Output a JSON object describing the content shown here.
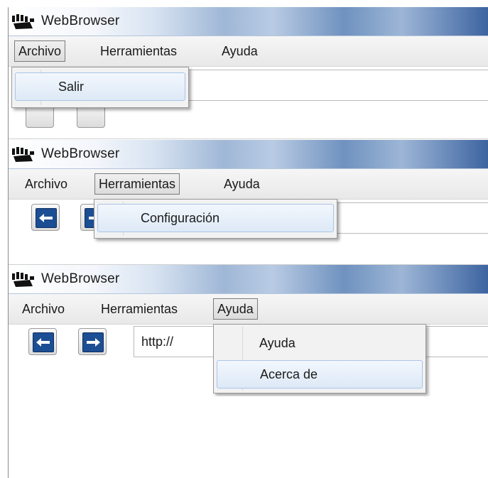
{
  "app": {
    "title": "WebBrowser"
  },
  "menu": {
    "archivo": "Archivo",
    "herramientas": "Herramientas",
    "ayuda": "Ayuda"
  },
  "dropdowns": {
    "archivo": [
      {
        "label": "Salir"
      }
    ],
    "herramientas": [
      {
        "label": "Configuración"
      }
    ],
    "ayuda": [
      {
        "label": "Ayuda"
      },
      {
        "label": "Acerca de"
      }
    ]
  },
  "address": {
    "value": "http://"
  },
  "icons": {
    "logo": "paw-logo-icon",
    "back": "arrow-left-icon",
    "forward": "arrow-right-icon"
  },
  "colors": {
    "accent": "#1c4e94",
    "menu_hover": "#dde9f6"
  }
}
